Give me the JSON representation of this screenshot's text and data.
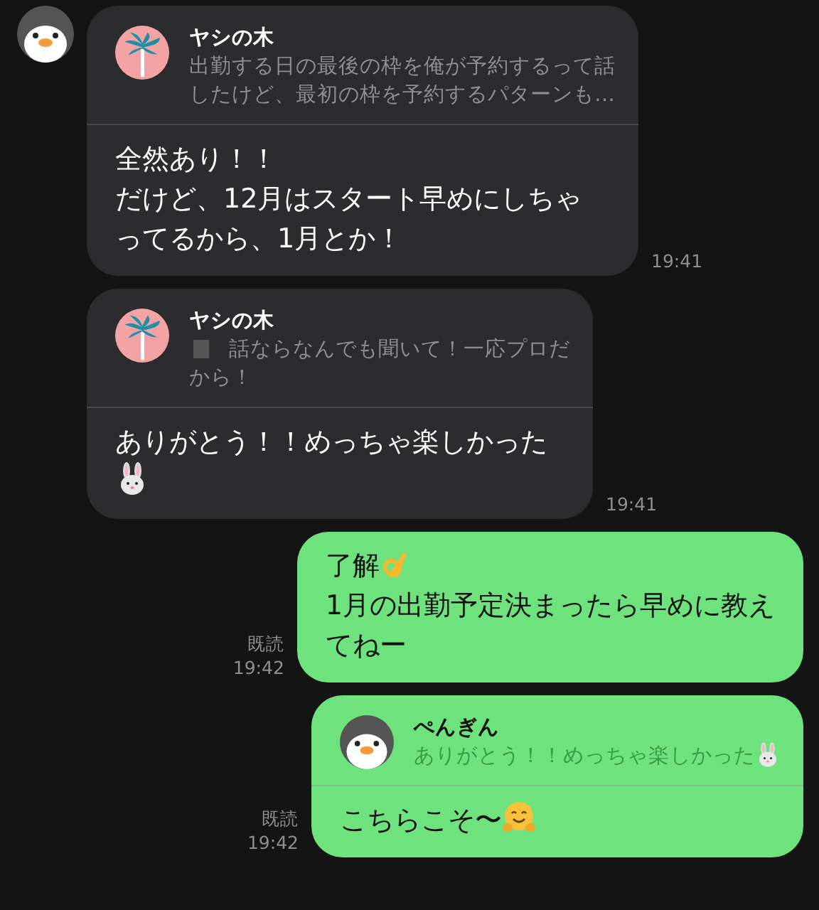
{
  "messages": [
    {
      "kind": "incoming",
      "quote": {
        "name": "ヤシの木",
        "lines": [
          "出勤する日の最後の枠を俺が予約するって話",
          "したけど、最初の枠を予約するパターンも…"
        ]
      },
      "lines": [
        "全然あり！！",
        "だけど、12月はスタート早めにしちゃ",
        "ってるから、1月とか！"
      ],
      "time": "19:41"
    },
    {
      "kind": "incoming",
      "quote": {
        "name": "ヤシの木",
        "lines": [
          "話ならなんでも聞いて！一応プロだ",
          "から！"
        ]
      },
      "lines": [
        "ありがとう！！めっちゃ楽しかった"
      ],
      "time": "19:41"
    },
    {
      "kind": "outgoing",
      "lines": [
        "了解",
        "1月の出勤予定決まったら早めに教え",
        "てねー"
      ],
      "read": "既読",
      "time": "19:42"
    },
    {
      "kind": "outgoing",
      "quote": {
        "name": "ぺんぎん",
        "lines": [
          "ありがとう！！めっちゃ楽しかった"
        ]
      },
      "lines": [
        "こちらこそ〜"
      ],
      "read": "既読",
      "time": "19:42"
    }
  ]
}
